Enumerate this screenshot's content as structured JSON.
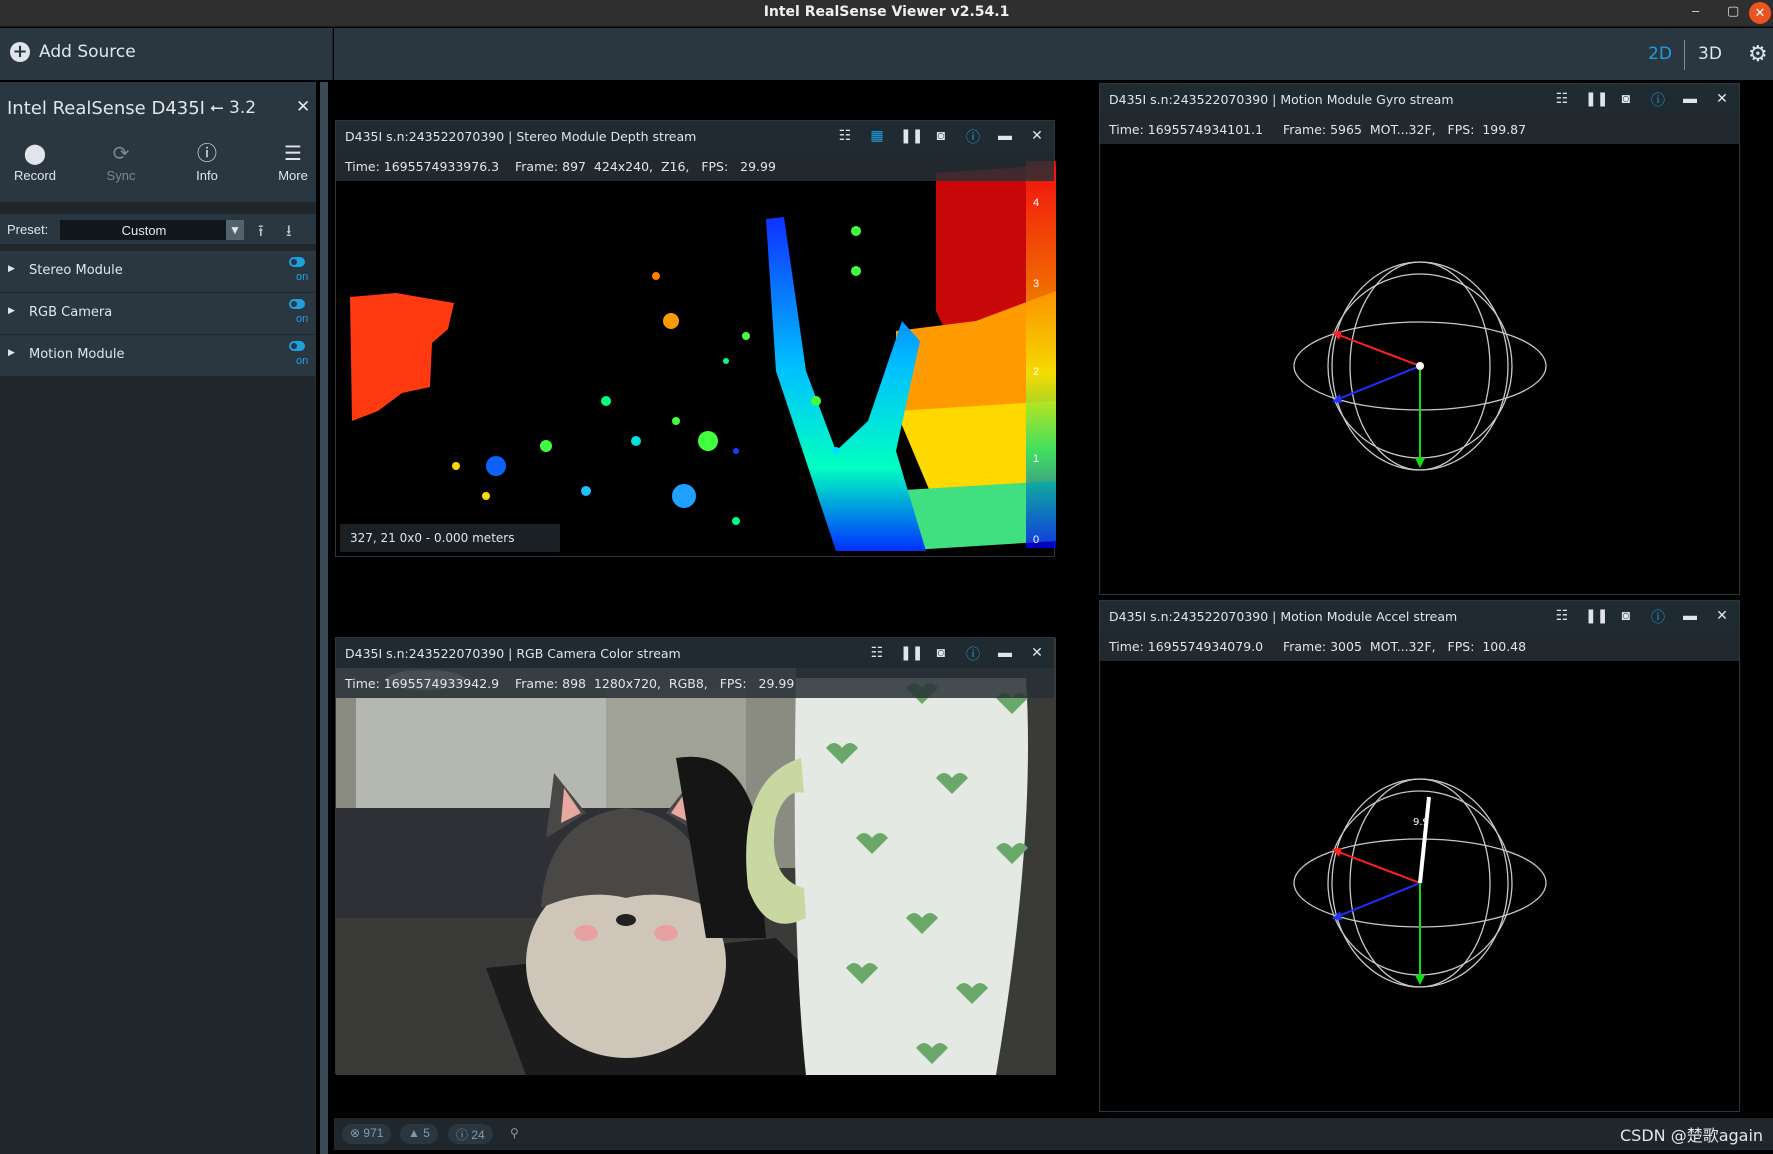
{
  "window": {
    "title": "Intel RealSense Viewer v2.54.1"
  },
  "toolbar": {
    "add_source": "Add Source",
    "mode_2d": "2D",
    "mode_3d": "3D"
  },
  "device": {
    "name": "Intel RealSense D435I",
    "usb": "3.2",
    "tools": [
      {
        "label": "Record",
        "icon": "record-icon"
      },
      {
        "label": "Sync",
        "icon": "sync-icon"
      },
      {
        "label": "Info",
        "icon": "info-icon"
      },
      {
        "label": "More",
        "icon": "menu-icon"
      }
    ],
    "preset_label": "Preset:",
    "preset_value": "Custom",
    "modules": [
      {
        "label": "Stereo Module",
        "state": "on"
      },
      {
        "label": "RGB Camera",
        "state": "on"
      },
      {
        "label": "Motion Module",
        "state": "on"
      }
    ]
  },
  "streams": {
    "depth": {
      "title": "D435I s.n:243522070390 | Stereo Module Depth stream",
      "info": "Time: 1695574933976.3    Frame: 897  424x240,  Z16,   FPS:   29.99",
      "overlay": "327, 21 0x0 - 0.000 meters",
      "scale": [
        "4",
        "3",
        "2",
        "1",
        "0"
      ]
    },
    "color": {
      "title": "D435I s.n:243522070390 | RGB Camera Color stream",
      "info": "Time: 1695574933942.9    Frame: 898  1280x720,  RGB8,   FPS:   29.99"
    },
    "gyro": {
      "title": "D435I s.n:243522070390 | Motion Module Gyro stream",
      "info": "Time: 1695574934101.1     Frame: 5965  MOT...32F,   FPS:  199.87"
    },
    "accel": {
      "title": "D435I s.n:243522070390 | Motion Module Accel stream",
      "info": "Time: 1695574934079.0     Frame: 3005  MOT...32F,   FPS:  100.48",
      "magnitude": "9.9"
    }
  },
  "status": {
    "errors": "971",
    "warnings": "5",
    "info": "24"
  },
  "watermark": "CSDN @楚歌again",
  "colors": {
    "accent": "#1ea0e0",
    "panel": "#2a3640",
    "close": "#e95420"
  }
}
